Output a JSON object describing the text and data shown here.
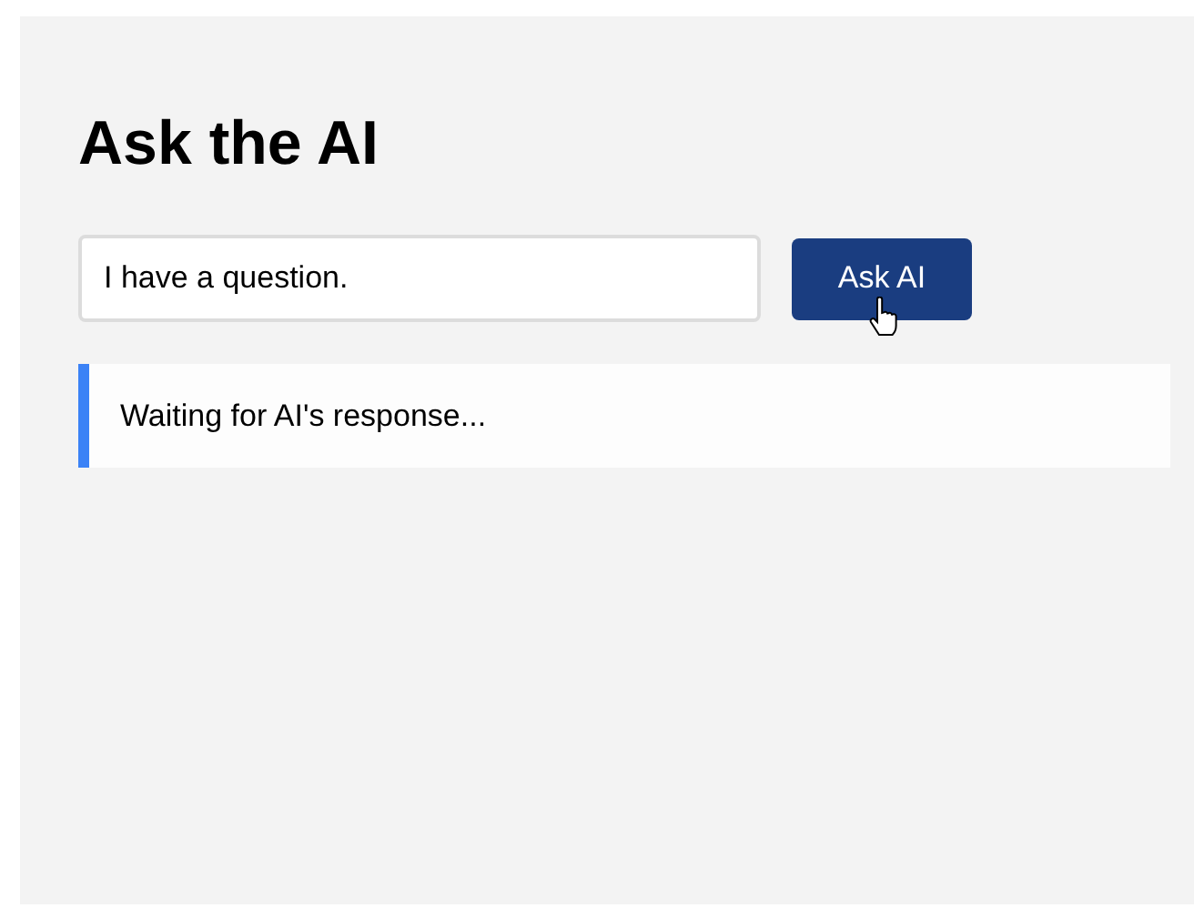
{
  "title": "Ask the AI",
  "question_field": {
    "value": "I have a question."
  },
  "ask_button": {
    "label": "Ask AI"
  },
  "response": {
    "text": "Waiting for AI's response..."
  }
}
